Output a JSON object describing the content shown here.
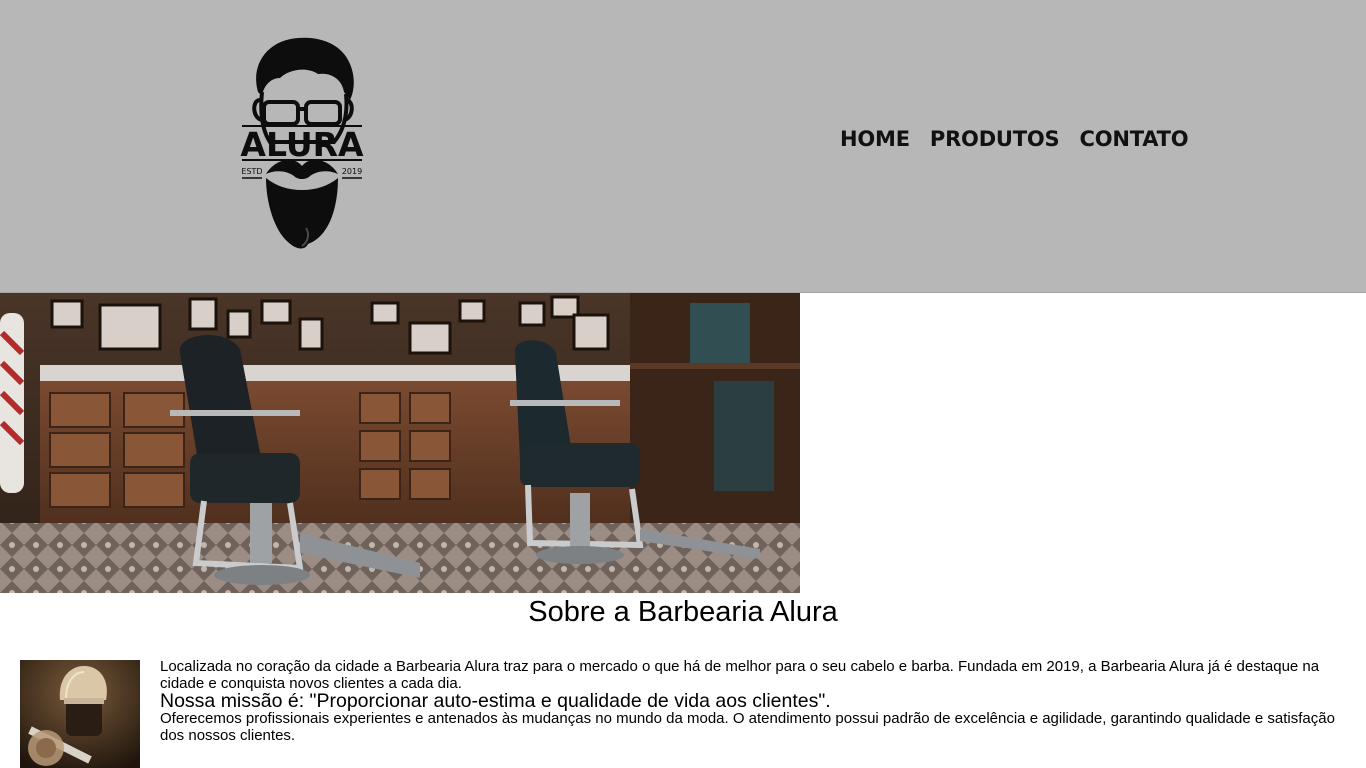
{
  "header": {
    "logo": {
      "brand_text": "ALURA",
      "estd_text": "ESTD",
      "year_text": "2019",
      "icon": "bearded-man-logo-icon"
    },
    "nav": [
      {
        "label": "HOME"
      },
      {
        "label": "PRODUTOS"
      },
      {
        "label": "CONTATO"
      }
    ]
  },
  "banner": {
    "icon": "barbershop-interior-photo"
  },
  "about": {
    "title": "Sobre a Barbearia Alura",
    "image_icon": "shaving-brush-photo",
    "paragraph1": "Localizada no coração da cidade a Barbearia Alura traz para o mercado o que há de melhor para o seu cabelo e barba. Fundada em 2019, a Barbearia Alura já é destaque na cidade e conquista novos clientes a cada dia.",
    "mission": "Nossa missão é: \"Proporcionar auto-estima e qualidade de vida aos clientes\".",
    "paragraph2": "Oferecemos profissionais experientes e antenados às mudanças no mundo da moda. O atendimento possui padrão de excelência e agilidade, garantindo qualidade e satisfação dos nossos clientes."
  },
  "colors": {
    "header_bg": "#b7b7b7",
    "text": "#000000",
    "background": "#ffffff"
  }
}
